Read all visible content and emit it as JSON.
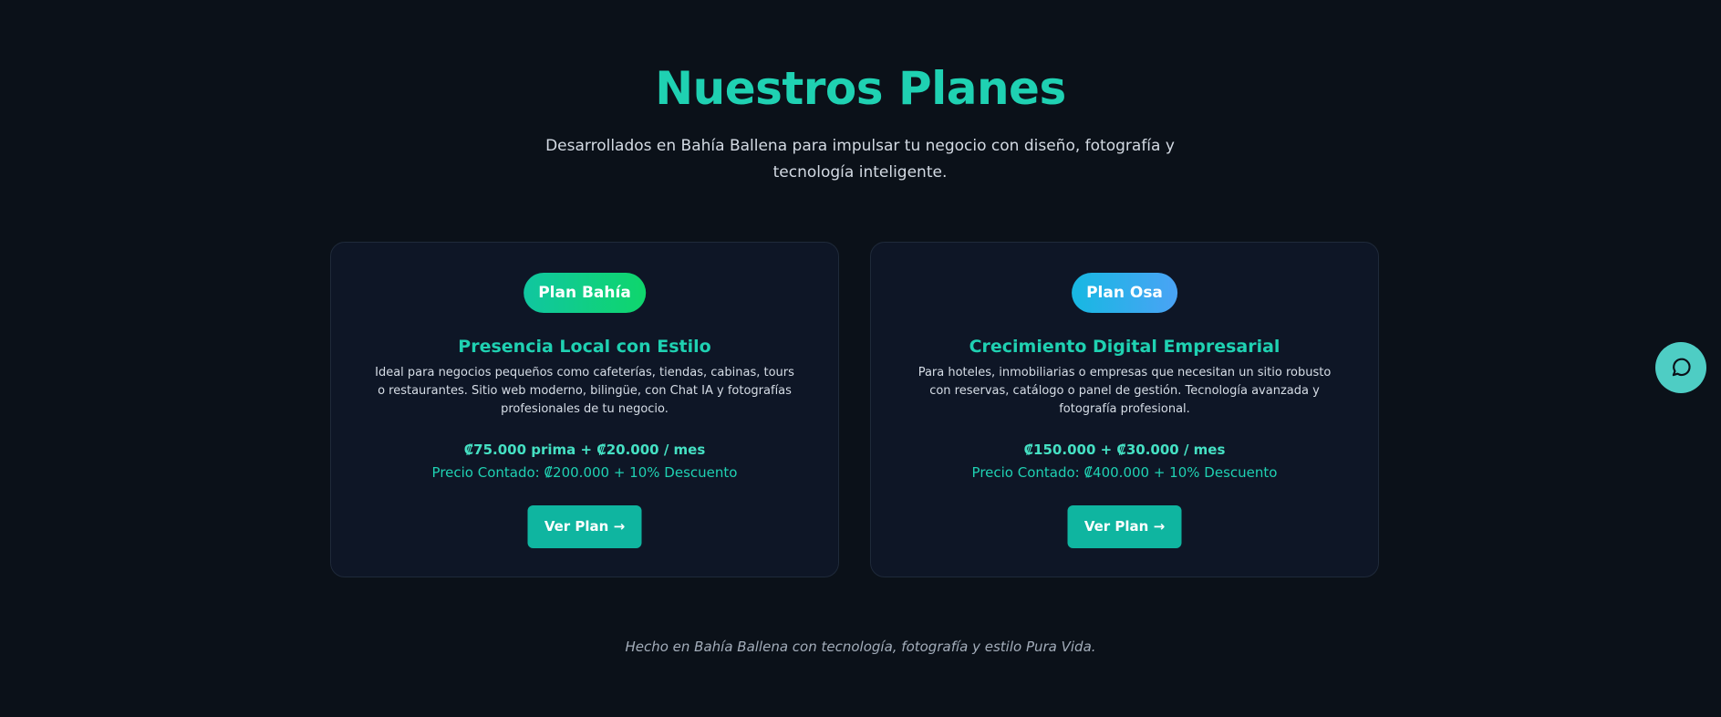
{
  "header": {
    "title": "Nuestros Planes",
    "subtitle": "Desarrollados en Bahía Ballena para impulsar tu negocio con diseño, fotografía y tecnología inteligente."
  },
  "plans": [
    {
      "badge": "Plan Bahía",
      "title": "Presencia Local con Estilo",
      "description": "Ideal para negocios pequeños como cafeterías, tiendas, cabinas, tours o restaurantes. Sitio web moderno, bilingüe, con Chat IA y fotografías profesionales de tu negocio.",
      "price": "₡75.000 prima + ₡20.000 / mes",
      "cash_price": "Precio Contado: ₡200.000 + 10% Descuento",
      "button_label": "Ver Plan →"
    },
    {
      "badge": "Plan Osa",
      "title": "Crecimiento Digital Empresarial",
      "description": "Para hoteles, inmobiliarias o empresas que necesitan un sitio robusto con reservas, catálogo o panel de gestión. Tecnología avanzada y fotografía profesional.",
      "price": "₡150.000 + ₡30.000 / mes",
      "cash_price": "Precio Contado: ₡400.000 + 10% Descuento",
      "button_label": "Ver Plan →"
    }
  ],
  "footer": {
    "text": "Hecho en Bahía Ballena con tecnología, fotografía y estilo Pura Vida."
  },
  "chat": {
    "icon": "chat-bubble-icon"
  },
  "colors": {
    "background": "#0b1119",
    "accent": "#1fd1b2",
    "card": "#0e1626",
    "button": "#0fb5a0",
    "chat_button": "#4ecdc4"
  }
}
